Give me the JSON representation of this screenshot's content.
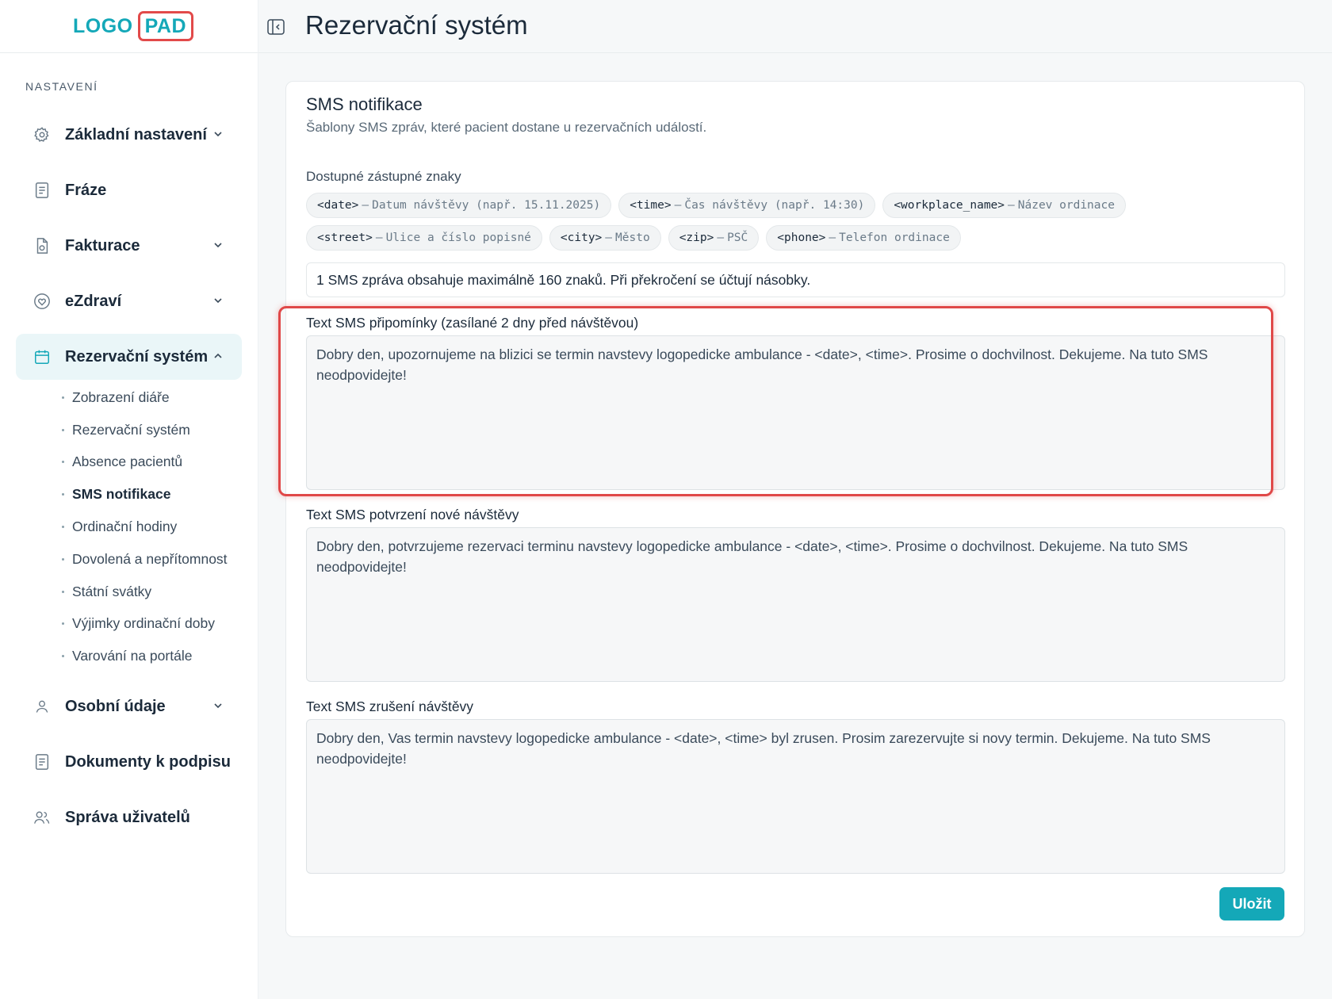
{
  "logo": {
    "part1": "LOGO",
    "part2": "PAD"
  },
  "nav": {
    "section": "NASTAVENÍ",
    "items": [
      {
        "label": "Základní nastavení",
        "icon": "gear-icon"
      },
      {
        "label": "Fráze",
        "icon": "document-icon"
      },
      {
        "label": "Fakturace",
        "icon": "invoice-icon"
      },
      {
        "label": "eZdraví",
        "icon": "heart-shield-icon"
      },
      {
        "label": "Rezervační systém",
        "icon": "calendar-icon"
      },
      {
        "label": "Osobní údaje",
        "icon": "user-icon"
      },
      {
        "label": "Dokumenty k podpisu",
        "icon": "document-icon"
      },
      {
        "label": "Správa uživatelů",
        "icon": "users-icon"
      }
    ],
    "sub_items": [
      "Zobrazení diáře",
      "Rezervační systém",
      "Absence pacientů",
      "SMS notifikace",
      "Ordinační hodiny",
      "Dovolená a nepřítomnost",
      "Státní svátky",
      "Výjimky ordinační doby",
      "Varování na portále"
    ]
  },
  "header": {
    "title": "Rezervační systém"
  },
  "card": {
    "title": "SMS notifikace",
    "subtitle": "Šablony SMS zpráv, které pacient dostane u rezervačních událostí.",
    "placeholders_label": "Dostupné zástupné znaky",
    "placeholders": [
      {
        "tag": "<date>",
        "desc": "Datum návštěvy (např. 15.11.2025)"
      },
      {
        "tag": "<time>",
        "desc": "Čas návštěvy (např. 14:30)"
      },
      {
        "tag": "<workplace_name>",
        "desc": "Název ordinace"
      },
      {
        "tag": "<street>",
        "desc": "Ulice a číslo popisné"
      },
      {
        "tag": "<city>",
        "desc": "Město"
      },
      {
        "tag": "<zip>",
        "desc": "PSČ"
      },
      {
        "tag": "<phone>",
        "desc": "Telefon ordinace"
      }
    ],
    "dash": "–",
    "info": "1 SMS zpráva obsahuje maximálně 160 znaků. Při překročení se účtují násobky.",
    "fields": [
      {
        "label": "Text SMS připomínky (zasílané 2 dny před návštěvou)",
        "value": "Dobry den, upozornujeme na blizici se termin navstevy logopedicke ambulance - <date>, <time>. Prosime o dochvilnost. Dekujeme. Na tuto SMS neodpovidejte!"
      },
      {
        "label": "Text SMS potvrzení nové návštěvy",
        "value": "Dobry den, potvrzujeme rezervaci terminu navstevy logopedicke ambulance - <date>, <time>. Prosime o dochvilnost. Dekujeme. Na tuto SMS neodpovidejte!"
      },
      {
        "label": "Text SMS zrušení návštěvy",
        "value": "Dobry den, Vas termin navstevy logopedicke ambulance - <date>, <time> byl zrusen. Prosim zarezervujte si novy termin. Dekujeme. Na tuto SMS neodpovidejte!"
      }
    ],
    "save_label": "Uložit"
  },
  "colors": {
    "accent": "#14a8b8",
    "highlight": "#e04848",
    "active_bg": "#eaf6f8"
  }
}
